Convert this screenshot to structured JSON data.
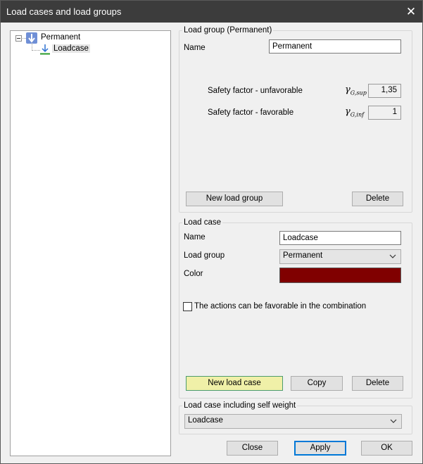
{
  "window": {
    "title": "Load cases and load groups",
    "close_glyph": "✕"
  },
  "tree": {
    "items": [
      {
        "label": "Permanent",
        "icon": "load-group-icon"
      },
      {
        "label": "Loadcase",
        "icon": "load-case-arrow-icon"
      }
    ]
  },
  "load_group": {
    "legend": "Load group (Permanent)",
    "name_label": "Name",
    "name_value": "Permanent",
    "unfavorable_label": "Safety factor - unfavorable",
    "unfavorable_symbol": "γ",
    "unfavorable_sub": "G,sup",
    "unfavorable_value": "1,35",
    "favorable_label": "Safety factor - favorable",
    "favorable_symbol": "γ",
    "favorable_sub": "G,inf",
    "favorable_value": "1",
    "new_button": "New load group",
    "delete_button": "Delete"
  },
  "load_case": {
    "legend": "Load case",
    "name_label": "Name",
    "name_value": "Loadcase",
    "group_label": "Load group",
    "group_value": "Permanent",
    "color_label": "Color",
    "color_value": "#800000",
    "favorable_checkbox_label": "The actions can be favorable in the combination",
    "favorable_checked": false,
    "new_button": "New load case",
    "copy_button": "Copy",
    "delete_button": "Delete"
  },
  "self_weight": {
    "legend": "Load case including self weight",
    "value": "Loadcase"
  },
  "footer": {
    "close": "Close",
    "apply": "Apply",
    "ok": "OK"
  }
}
